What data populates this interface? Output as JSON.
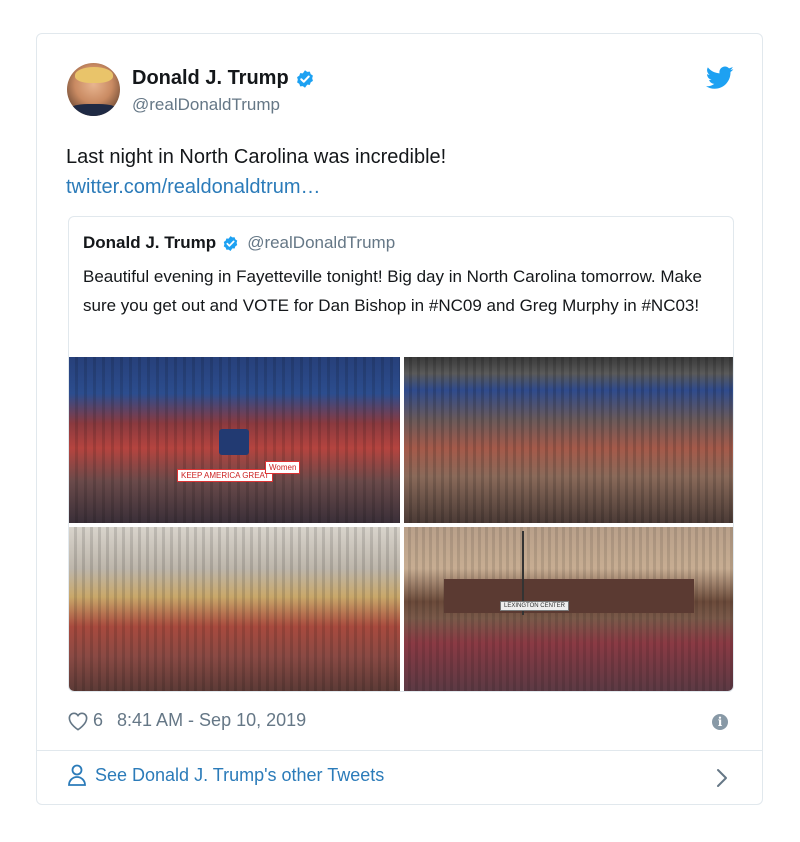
{
  "tweet": {
    "author_name": "Donald J. Trump",
    "author_handle": "@realDonaldTrump",
    "text": "Last night in North Carolina was incredible!",
    "link": "twitter.com/realdonaldtrum…",
    "likes": "6",
    "timestamp": "8:41 AM - Sep 10, 2019"
  },
  "quoted": {
    "author_name": "Donald J. Trump",
    "author_handle": "@realDonaldTrump",
    "text": "Beautiful evening in Fayetteville tonight! Big day in North Carolina tomorrow. Make sure you get out and VOTE for Dan Bishop in #NC09 and Greg Murphy in #NC03!"
  },
  "photo_signs": {
    "keep_america_great": "KEEP AMERICA GREAT",
    "women": "Women",
    "arena_banner": "LEXINGTON CENTER"
  },
  "footer": {
    "see_more": "See Donald J. Trump's other Tweets"
  },
  "icons": {
    "verified": "verified-badge-icon",
    "bird": "twitter-bird-icon",
    "heart": "heart-icon",
    "info": "info-icon",
    "person": "person-icon",
    "chevron": "chevron-right-icon"
  },
  "colors": {
    "brand_blue": "#1da1f2",
    "link_blue": "#2b7bb9",
    "muted_text": "#657786",
    "border": "#e1e8ed"
  }
}
